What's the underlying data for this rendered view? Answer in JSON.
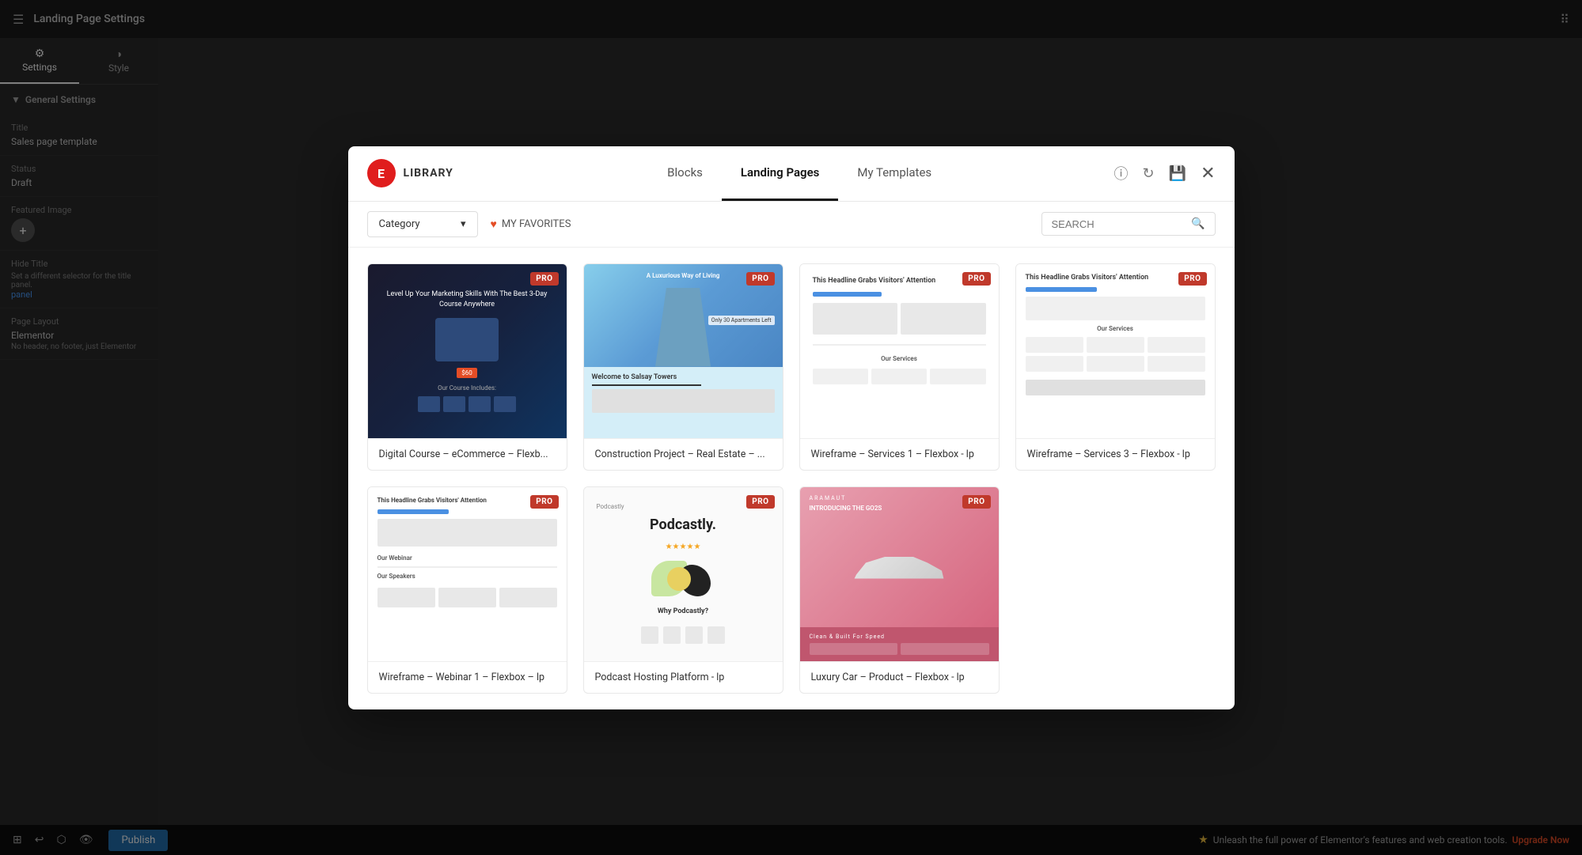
{
  "app": {
    "title": "Landing Page Settings"
  },
  "topbar": {
    "title": "Landing Page Settings"
  },
  "settings_panel": {
    "tab_settings": "Settings",
    "tab_style": "Style",
    "general_settings_header": "General Settings",
    "fields": {
      "title_label": "Title",
      "title_value": "Sales page template",
      "status_label": "Status",
      "status_value": "Draft",
      "featured_image_label": "Featured Image",
      "hide_title_label": "Hide Title",
      "hide_title_desc": "Set a different selector for the title panel.",
      "page_layout_label": "Page Layout",
      "page_layout_value": "Elementor",
      "page_layout_desc": "No header, no footer, just Elementor"
    }
  },
  "bottom_bar": {
    "publish_label": "Publish",
    "promo_text": "Unleash the full power of Elementor's features and web creation tools.",
    "upgrade_label": "Upgrade Now"
  },
  "modal": {
    "logo_letter": "E",
    "library_label": "LIBRARY",
    "tabs": [
      {
        "id": "blocks",
        "label": "Blocks"
      },
      {
        "id": "landing-pages",
        "label": "Landing Pages"
      },
      {
        "id": "my-templates",
        "label": "My Templates"
      }
    ],
    "active_tab": "landing-pages",
    "category_label": "Category",
    "favorites_label": "MY FAVORITES",
    "search_placeholder": "SEARCH",
    "templates": [
      {
        "id": "t1",
        "title": "Digital Course – eCommerce – Flexb...",
        "is_pro": true,
        "thumb_type": "digital"
      },
      {
        "id": "t2",
        "title": "Construction Project – Real Estate – ...",
        "is_pro": true,
        "thumb_type": "construction"
      },
      {
        "id": "t3",
        "title": "Wireframe – Services 1 – Flexbox - lp",
        "is_pro": true,
        "thumb_type": "wireframe1"
      },
      {
        "id": "t4",
        "title": "Wireframe – Services 3 – Flexbox - lp",
        "is_pro": true,
        "thumb_type": "wireframe2"
      },
      {
        "id": "t5",
        "title": "Wireframe – Webinar 1 – Flexbox – lp",
        "is_pro": true,
        "thumb_type": "webinar"
      },
      {
        "id": "t6",
        "title": "Podcast Hosting Platform - lp",
        "is_pro": true,
        "thumb_type": "podcast"
      },
      {
        "id": "t7",
        "title": "Luxury Car – Product – Flexbox - lp",
        "is_pro": true,
        "thumb_type": "car"
      }
    ],
    "pro_badge_text": "PRO",
    "wireframe_headline": "This Headline Grabs Visitors' Attention",
    "wireframe_services": "Our Services",
    "digital_headline": "Level Up Your Marketing Skills With The Best 3-Day Course Anywhere",
    "digital_price": "$60",
    "digital_includes": "Our Course Includes:",
    "construction_headline": "A Luxurious Way of Living",
    "construction_sub": "Only 30 Apartments Left",
    "construction_welcome": "Welcome to Salsay Towers",
    "podcast_title": "Podcastly.",
    "podcast_why": "Why Podcastly?",
    "car_brand": "ARAMAUT",
    "car_intro": "INTRODUCING THE GO2S",
    "car_tagline": "Clean & Built For Speed"
  }
}
